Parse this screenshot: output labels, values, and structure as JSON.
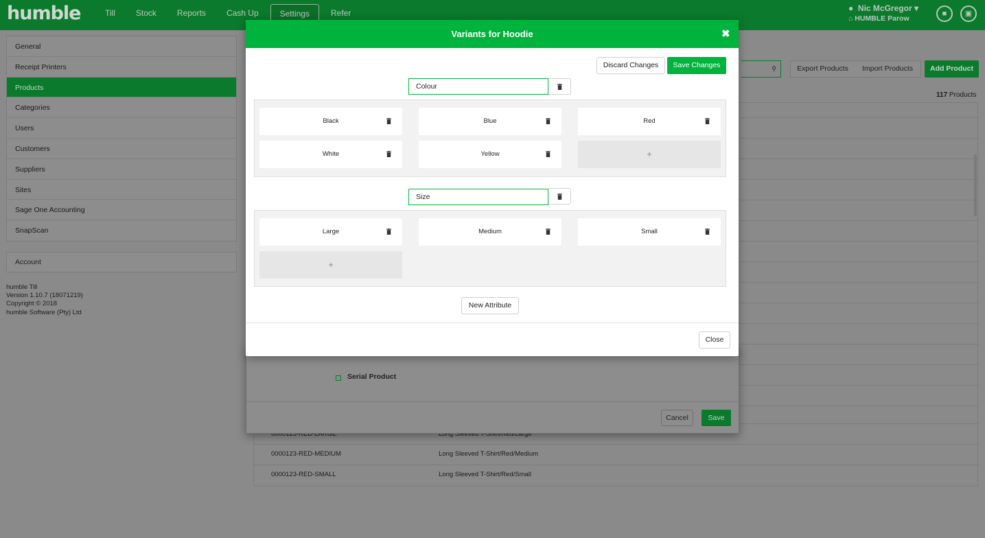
{
  "app": {
    "logo": "humble",
    "nav": [
      "Till",
      "Stock",
      "Reports",
      "Cash Up",
      "Settings",
      "Refer"
    ],
    "active_nav": "Settings",
    "user_name": "Nic McGregor",
    "user_site": "HUMBLE Parow",
    "accent_color": "#00b33c"
  },
  "sidebar": {
    "items": [
      "General",
      "Receipt Printers",
      "Products",
      "Categories",
      "Users",
      "Customers",
      "Suppliers",
      "Sites",
      "Sage One Accounting",
      "SnapScan"
    ],
    "active": "Products",
    "account": "Account",
    "version_lines": [
      "humble Till",
      "Version 1.10.7 (18071219)",
      "Copyright © 2018",
      "humble Software (Pty) Ltd"
    ]
  },
  "products_page": {
    "export_label": "Export Products",
    "import_label": "Import Products",
    "add_label": "Add Product",
    "count_number": "117",
    "count_suffix": "Products",
    "rows": [
      {
        "sku": "0000123-RED-LARGE",
        "name": "Long Sleeved T-Shirt/Red/Large"
      },
      {
        "sku": "0000123-RED-MEDIUM",
        "name": "Long Sleeved T-Shirt/Red/Medium"
      },
      {
        "sku": "0000123-RED-SMALL",
        "name": "Long Sleeved T-Shirt/Red/Small"
      }
    ]
  },
  "product_modal": {
    "serial_label": "Serial Product",
    "cancel_label": "Cancel",
    "save_label": "Save"
  },
  "variants_modal": {
    "title": "Variants for Hoodie",
    "discard_label": "Discard Changes",
    "save_label": "Save Changes",
    "attributes": [
      {
        "name": "Colour",
        "values": [
          "Black",
          "Blue",
          "Red",
          "White",
          "Yellow"
        ]
      },
      {
        "name": "Size",
        "values": [
          "Large",
          "Medium",
          "Small"
        ]
      }
    ],
    "add_value_symbol": "+",
    "new_attribute_label": "New Attribute",
    "close_label": "Close"
  }
}
